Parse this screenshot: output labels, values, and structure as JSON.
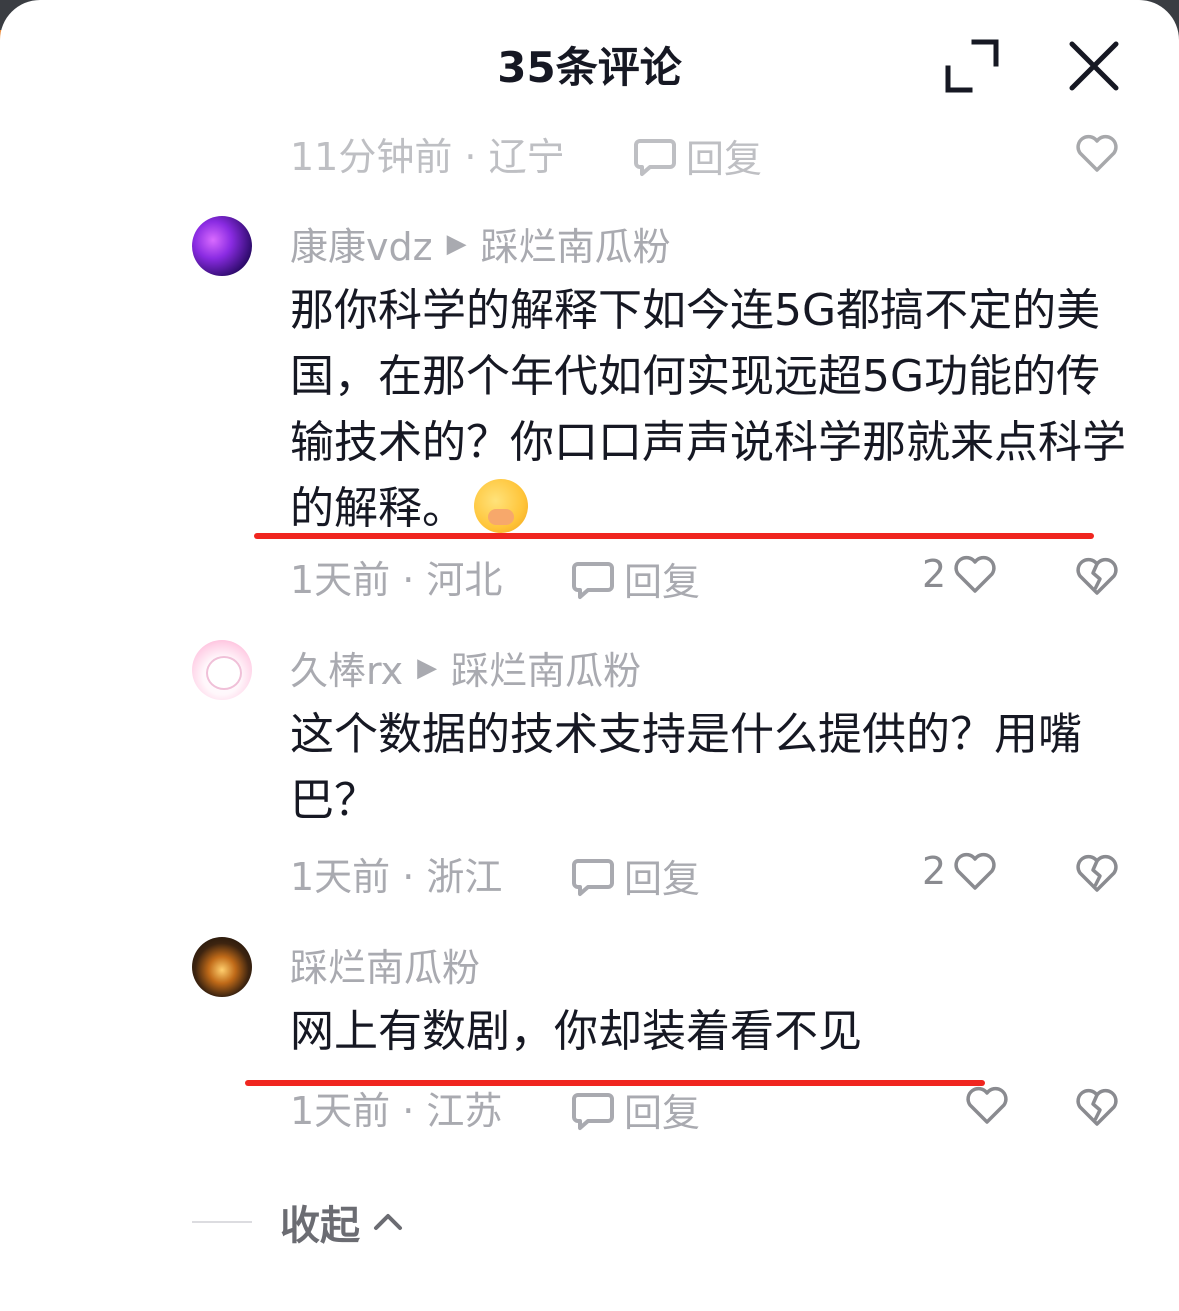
{
  "header": {
    "title": "35条评论",
    "expand_icon": "expand-icon",
    "close_icon": "close-icon"
  },
  "partial_comment": {
    "meta": "11分钟前 · 辽宁",
    "reply_label": "回复"
  },
  "comments": [
    {
      "author": "康康vdz",
      "reply_to": "踩烂南瓜粉",
      "content": "那你科学的解释下如今连5G都搞不定的美国，在那个年代如何实现远超5G功能的传输技术的？你口口声声说科学那就来点科学的解释。",
      "emoji": "covering-mouth-emoji",
      "meta": "1天前 · 河北",
      "reply_label": "回复",
      "likes": "2"
    },
    {
      "author": "久棒rx",
      "reply_to": "踩烂南瓜粉",
      "content": "这个数据的技术支持是什么提供的？用嘴巴？",
      "meta": "1天前 · 浙江",
      "reply_label": "回复",
      "likes": "2"
    },
    {
      "author": "踩烂南瓜粉",
      "content": "网上有数剧，你却装着看不见",
      "meta": "1天前 · 江苏",
      "reply_label": "回复",
      "likes": ""
    }
  ],
  "collapse_label": "收起",
  "colors": {
    "underline": "#f0261f",
    "meta": "#a9aab0",
    "text": "#161823"
  }
}
